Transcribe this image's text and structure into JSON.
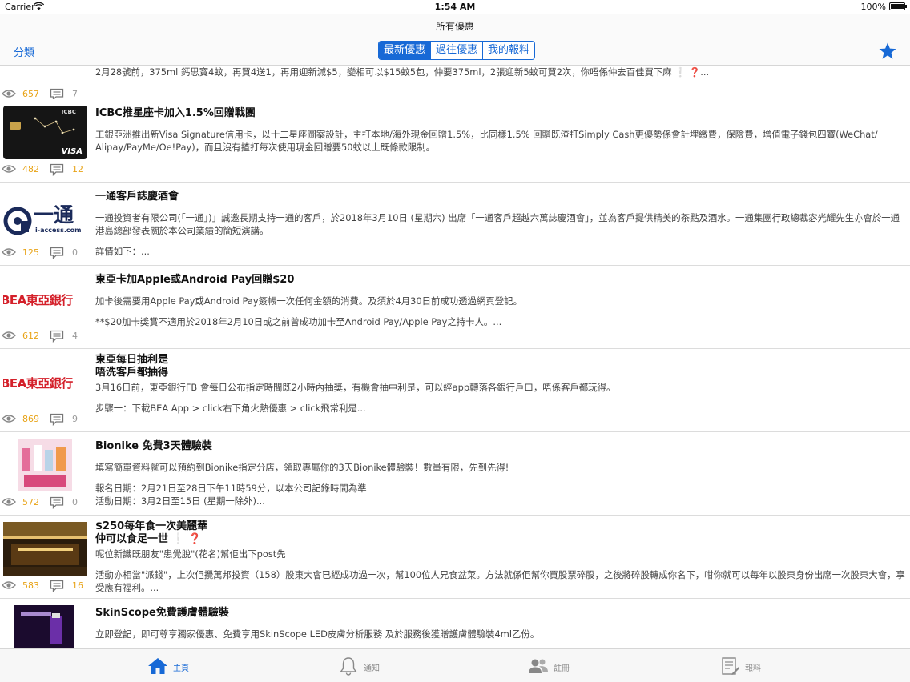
{
  "status_bar": {
    "carrier": "Carrier",
    "time": "1:54 AM",
    "battery": "100%"
  },
  "nav": {
    "title": "所有優惠",
    "left_button": "分類",
    "segments": [
      "最新優惠",
      "過往優惠",
      "我的報料"
    ],
    "selected_segment": "最新優惠",
    "right_icon": "star-icon",
    "accent_color": "#1769d6"
  },
  "posts": [
    {
      "title": "",
      "body": [
        "2月28號前，375ml 鈣思寶4蚊，再買4送1，再用迎新減$5，變相可以$15蚊5包，仲要375ml，2張迎新5蚊可買2次，你唔係仲去百佳買下麻 ❕ ❓..."
      ],
      "views": "657",
      "comments": "7"
    },
    {
      "title": "ICBC推星座卡加入1.5%回贈戰團",
      "body": [
        "工銀亞洲推出新Visa Signature信用卡，以十二星座圖案設計，主打本地/海外現金回贈1.5%，比同樣1.5% 回贈既渣打Simply Cash更優勢係會計埋繳費，保險費，增值電子錢包四寶(WeChat/ Alipay/PayMe/Oe!Pay)，而且沒有揸打每次使用現金回贈要50蚊以上既條款限制。"
      ],
      "thumb_text": [
        "ICBC",
        "VISA"
      ],
      "views": "482",
      "comments": "12"
    },
    {
      "title": "一通客戶誌慶酒會",
      "body": [
        "一通投資者有限公司(「一通」)」誠邀長期支持一通的客戶，於2018年3月10日 (星期六) 出席「一通客戶超越六萬誌慶酒會」，並為客戶提供精美的茶點及酒水。一通集團行政總裁宓光耀先生亦會於一通港島總部發表關於本公司業績的簡短演講。",
        "詳情如下：..."
      ],
      "logo_text": [
        "一通",
        "i-access.com"
      ],
      "views": "125",
      "comments": "0"
    },
    {
      "title": "東亞卡加Apple或Android Pay回贈$20",
      "body": [
        "加卡後需要用Apple Pay或Android Pay簽帳一次任何金額的消費。及須於4月30日前成功透過網頁登記。",
        "**$20加卡獎賞不適用於2018年2月10日或之前曾成功加卡至Android Pay/Apple Pay之持卡人。..."
      ],
      "logo_text": "BEA東亞銀行",
      "views": "612",
      "comments": "4"
    },
    {
      "title": "東亞每日抽利是\n唔洗客戶都抽得",
      "body": [
        "3月16日前，東亞銀行FB 會每日公布指定時間既2小時內抽獎，有機會抽中利是，可以經app轉落各銀行戶口，唔係客戶都玩得。",
        "步驟一：下載BEA App > click右下角火熱優惠 > click飛常利是..."
      ],
      "logo_text": "BEA東亞銀行",
      "views": "869",
      "comments": "9"
    },
    {
      "title": "Bionike 免費3天體驗裝",
      "body": [
        "填寫簡單資料就可以預約到Bionike指定分店，領取專屬你的3天Bionike體驗裝！數量有限，先到先得!",
        "報名日期：2月21日至28日下午11時59分，以本公司記錄時間為準\n活動日期：3月2日至15日 (星期一除外)..."
      ],
      "views": "572",
      "comments": "0"
    },
    {
      "title": "$250每年食一次美麗華\n仲可以食足一世 ❕ ❓",
      "body": [
        "呢位新識既朋友\"患覺脫\"(花名)幫佢出下post先",
        "活動亦相當\"派錢\"，上次佢攪萬邦投資（158）股東大會已經成功過一次，幫100位人兄食盆菜。方法就係佢幫你買股票碎股，之後將碎股轉成你名下，咁你就可以每年以股東身份出席一次股東大會，享受應有福利。..."
      ],
      "views": "583",
      "comments": "16"
    },
    {
      "title": "SkinScope免費護膚體驗裝",
      "body": [
        "立即登記，即可尊享獨家優惠、免費享用SkinScope LED皮膚分析服務 及於服務後獲贈護膚體驗裝4ml乙份。"
      ],
      "views": "",
      "comments": ""
    }
  ],
  "tabbar": {
    "tabs": [
      {
        "label": "主頁",
        "icon": "home-icon",
        "active": true
      },
      {
        "label": "通知",
        "icon": "bell-icon",
        "active": false
      },
      {
        "label": "註冊",
        "icon": "users-icon",
        "active": false
      },
      {
        "label": "報料",
        "icon": "report-icon",
        "active": false
      }
    ]
  }
}
